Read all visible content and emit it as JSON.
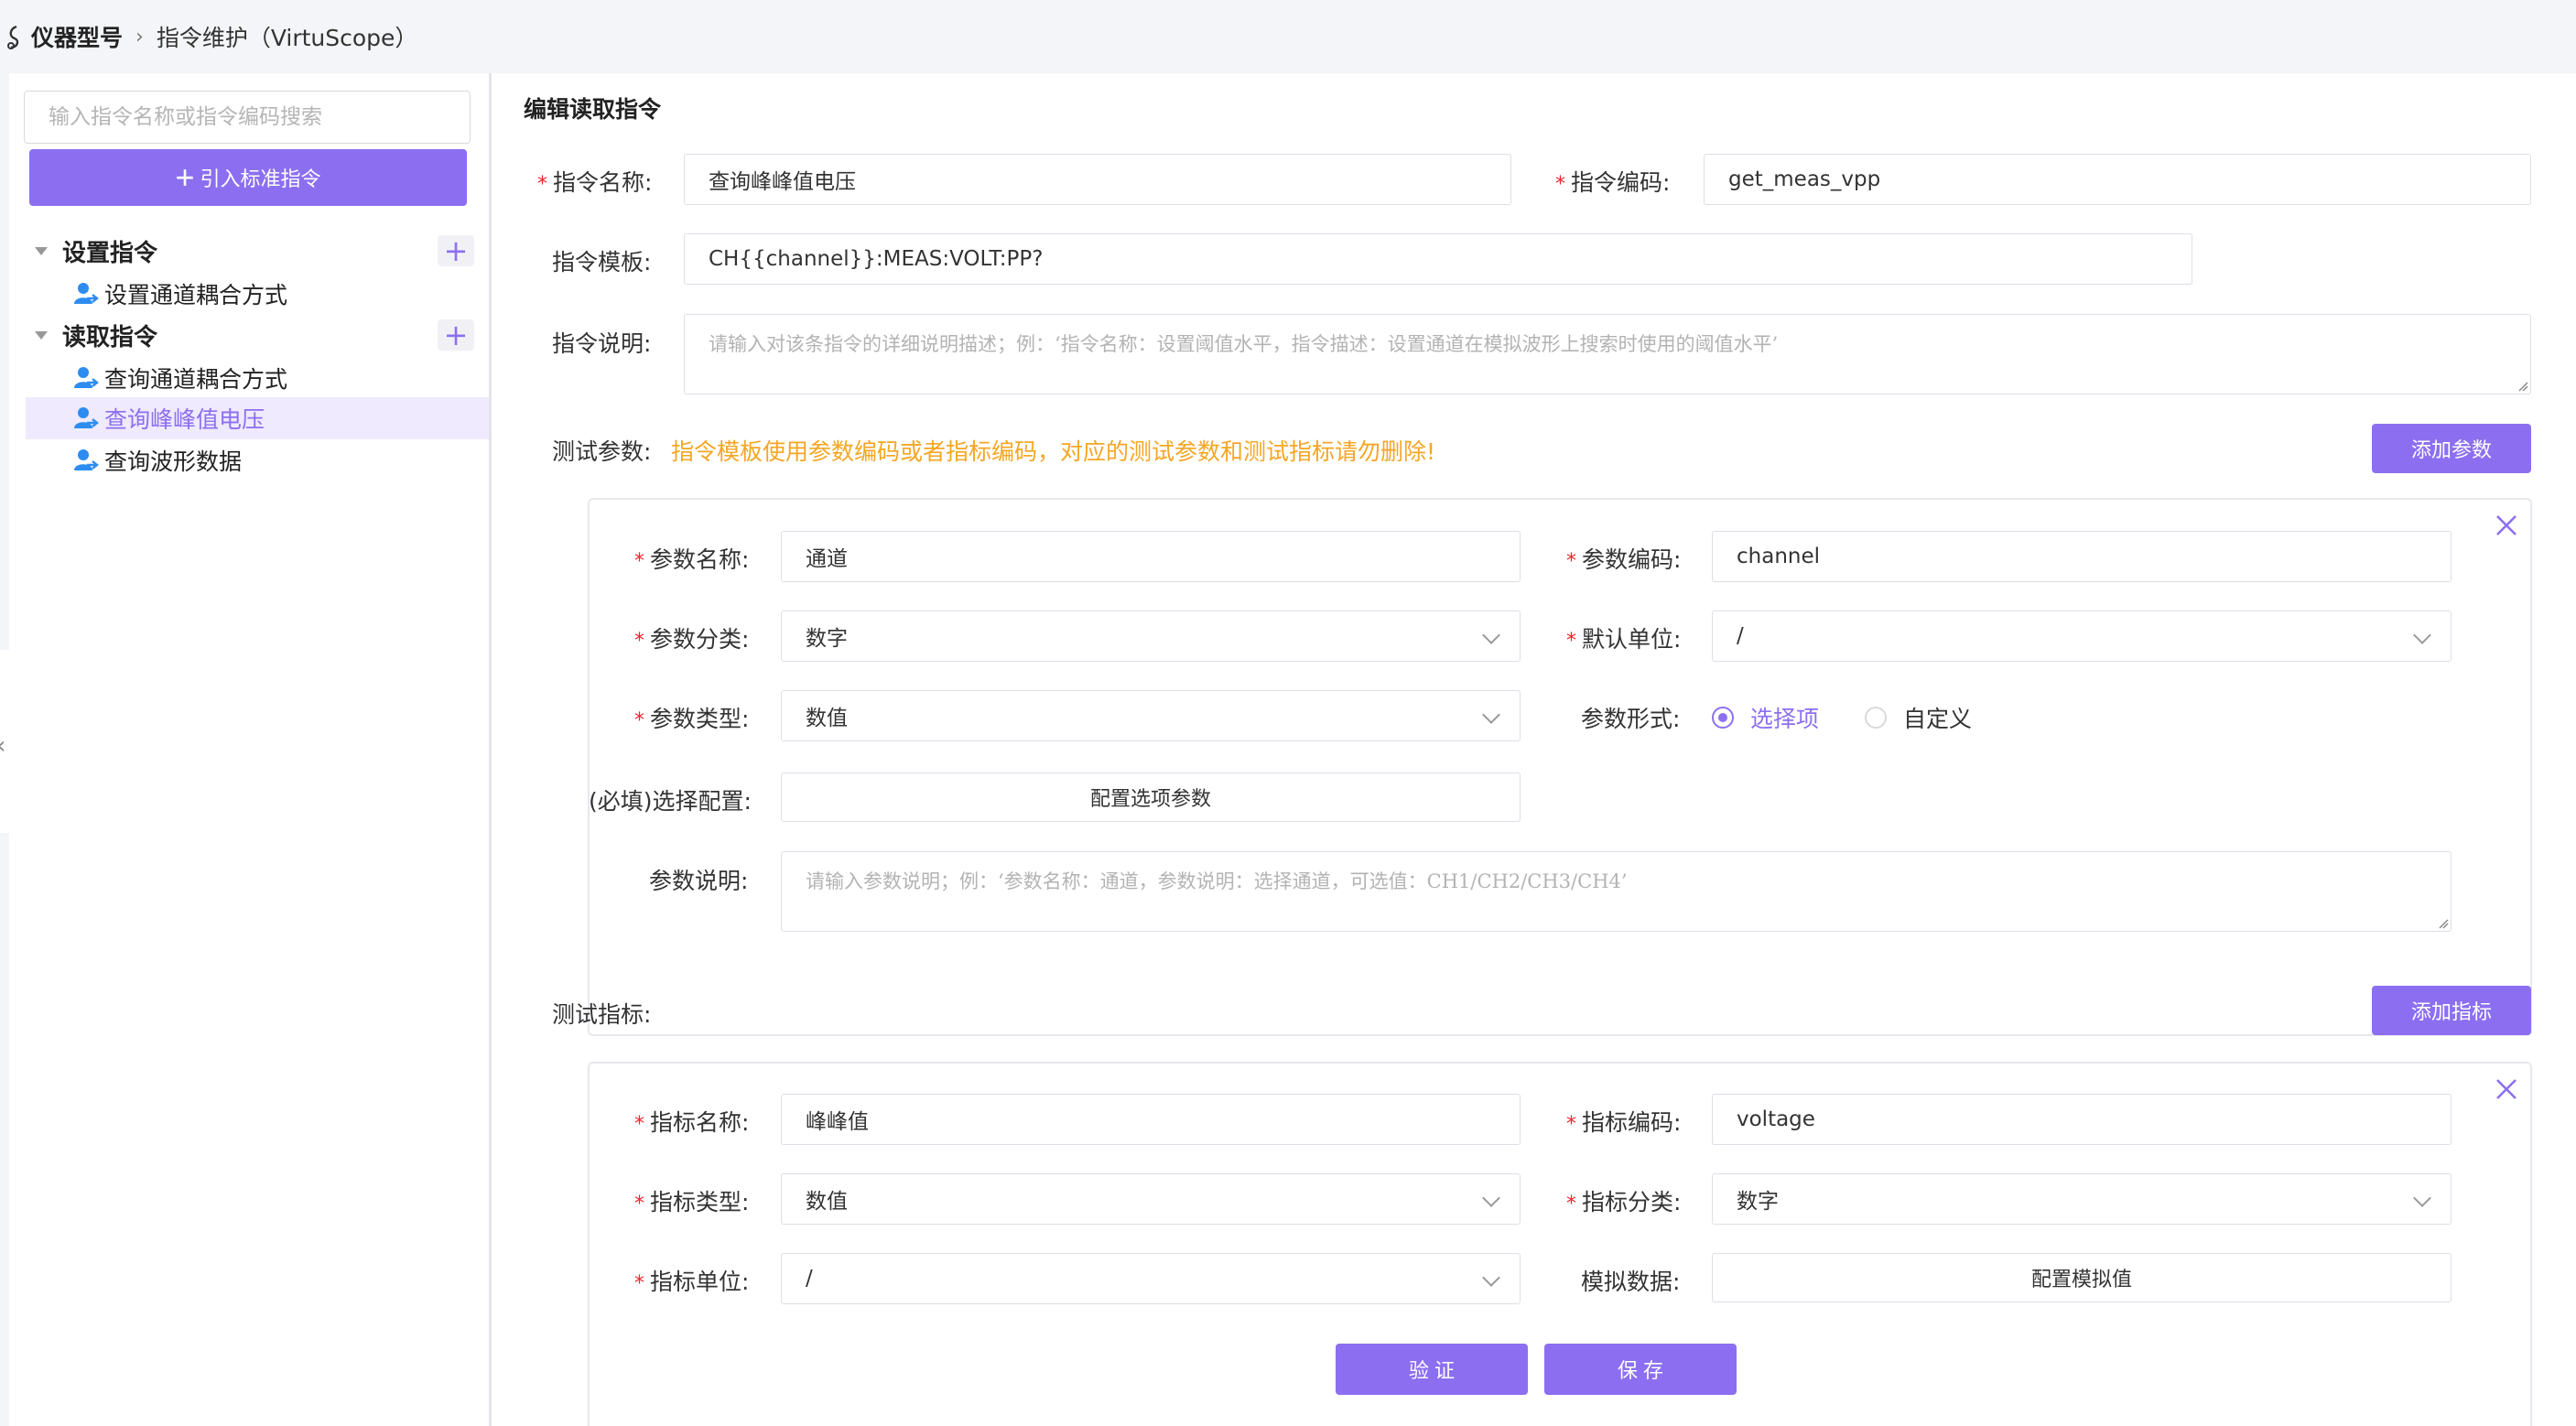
{
  "breadcrumb": {
    "root": "仪器型号",
    "current": "指令维护（VirtuScope）"
  },
  "sidebar": {
    "search_placeholder": "输入指令名称或指令编码搜索",
    "import_label": "引入标准指令",
    "groups": [
      {
        "label": "设置指令",
        "items": [
          "设置通道耦合方式"
        ]
      },
      {
        "label": "读取指令",
        "items": [
          "查询通道耦合方式",
          "查询峰峰值电压",
          "查询波形数据"
        ]
      }
    ],
    "active_item": "查询峰峰值电压"
  },
  "form": {
    "title": "编辑读取指令",
    "name_label": "指令名称:",
    "name_value": "查询峰峰值电压",
    "code_label": "指令编码:",
    "code_value": "get_meas_vpp",
    "template_label": "指令模板:",
    "template_value": "CH{{channel}}:MEAS:VOLT:PP?",
    "desc_label": "指令说明:",
    "desc_placeholder": "请输入对该条指令的详细说明描述；例：‘指令名称：设置阈值水平，指令描述：设置通道在模拟波形上搜索时使用的阈值水平’"
  },
  "params": {
    "label": "测试参数:",
    "warning": "指令模板使用参数编码或者指标编码，对应的测试参数和测试指标请勿删除!",
    "add_label": "添加参数",
    "name_label": "参数名称:",
    "name_value": "通道",
    "code_label": "参数编码:",
    "code_value": "channel",
    "category_label": "参数分类:",
    "category_value": "数字",
    "unit_label": "默认单位:",
    "unit_value": "/",
    "type_label": "参数类型:",
    "type_value": "数值",
    "form_label": "参数形式:",
    "form_options": [
      "选择项",
      "自定义"
    ],
    "form_selected": "选择项",
    "config_label": "(必填)选择配置:",
    "config_button": "配置选项参数",
    "desc_label": "参数说明:",
    "desc_placeholder": "请输入参数说明；例：‘参数名称：通道，参数说明：选择通道，可选值：CH1/CH2/CH3/CH4’"
  },
  "indicators": {
    "label": "测试指标:",
    "add_label": "添加指标",
    "name_label": "指标名称:",
    "name_value": "峰峰值",
    "code_label": "指标编码:",
    "code_value": "voltage",
    "type_label": "指标类型:",
    "type_value": "数值",
    "category_label": "指标分类:",
    "category_value": "数字",
    "unit_label": "指标单位:",
    "unit_value": "/",
    "mock_label": "模拟数据:",
    "mock_button": "配置模拟值"
  },
  "footer": {
    "verify_label": "验 证",
    "save_label": "保 存"
  },
  "colors": {
    "accent": "#8c6ff0",
    "warning": "#f5a623",
    "required": "#f5222d"
  }
}
